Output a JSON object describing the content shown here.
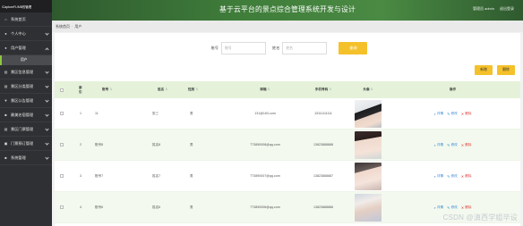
{
  "window": {
    "brand": "\\CaptureFL\\MB的管理"
  },
  "header": {
    "title": "基于云平台的景点综合管理系统开发与设计",
    "user_label": "管理员 admin",
    "logout_label": "退出登录"
  },
  "breadcrumb": {
    "home": "系统首页",
    "separator": "·",
    "current": "用户"
  },
  "sidebar": {
    "items": [
      {
        "label": "系统首页",
        "icon": "home-icon",
        "glyph": "⌂"
      },
      {
        "label": "个人中心",
        "icon": "user-icon",
        "glyph": "●"
      },
      {
        "label": "用户管理",
        "icon": "users-icon",
        "glyph": "●"
      },
      {
        "label": "景区信息管理",
        "icon": "info-icon",
        "glyph": "▤"
      },
      {
        "label": "景区分类管理",
        "icon": "category-icon",
        "glyph": "▤"
      },
      {
        "label": "景区公告管理",
        "icon": "notice-icon",
        "glyph": "▼"
      },
      {
        "label": "最美名宿管理",
        "icon": "hotel-icon",
        "glyph": "■"
      },
      {
        "label": "景区门票管理",
        "icon": "ticket-icon",
        "glyph": "▤"
      },
      {
        "label": "门票预订管理",
        "icon": "booking-icon",
        "glyph": "▣"
      },
      {
        "label": "系统管理",
        "icon": "settings-icon",
        "glyph": "■"
      }
    ],
    "submenu": {
      "label": "用户"
    }
  },
  "search": {
    "account_label": "账号",
    "account_placeholder": "账号",
    "name_label": "姓名",
    "name_placeholder": "姓名",
    "search_button": "查询"
  },
  "actions": {
    "add_label": "新增",
    "delete_label": "删除"
  },
  "table": {
    "headers": {
      "index": "索引",
      "account": "账号",
      "name": "姓名",
      "gender": "性别",
      "email": "邮箱",
      "phone": "手机号码",
      "avatar": "头像",
      "ops": "操作"
    },
    "sort_glyph": "⇅",
    "rows": [
      {
        "index": "1",
        "account": "11",
        "name": "张三",
        "gender": "男",
        "email": "131@163.com",
        "phone": "13111111111"
      },
      {
        "index": "2",
        "account": "账号8",
        "name": "姓名8",
        "gender": "男",
        "email": "773890008@qq.com",
        "phone": "13823888888"
      },
      {
        "index": "3",
        "account": "账号7",
        "name": "姓名7",
        "gender": "男",
        "email": "773890007@qq.com",
        "phone": "13823888887"
      },
      {
        "index": "4",
        "account": "账号6",
        "name": "姓名6",
        "gender": "男",
        "email": "773890006@qq.com",
        "phone": "13823888886"
      }
    ],
    "ops": {
      "detail": "详情",
      "edit": "修改",
      "delete": "删除"
    }
  },
  "watermark": "CSDN @滇西学姐毕设"
}
